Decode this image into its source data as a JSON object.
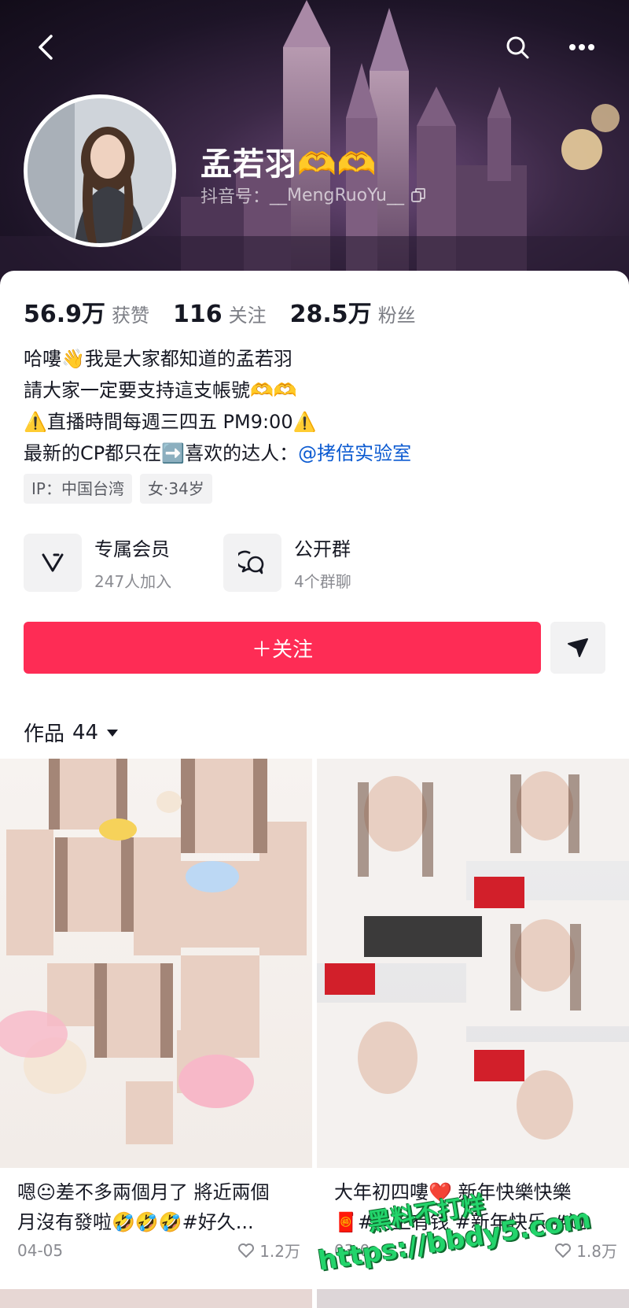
{
  "profile": {
    "name": "孟若羽🫶🫶",
    "id_label": "抖音号：",
    "id_value": "__MengRuoYu__"
  },
  "stats": [
    {
      "value": "56.9万",
      "label": "获赞"
    },
    {
      "value": "116",
      "label": "关注"
    },
    {
      "value": "28.5万",
      "label": "粉丝"
    }
  ],
  "bio": {
    "line1": "哈嘍👋我是大家都知道的孟若羽",
    "line2": "請大家一定要支持這支帳號🫶🫶",
    "line3": "⚠️直播時間每週三四五 PM9:00⚠️",
    "line4_prefix": "最新的CP都只在➡️喜欢的达人：",
    "line4_mention": "@拷倍实验室"
  },
  "tags": [
    "IP：中国台湾",
    "女·34岁"
  ],
  "features": [
    {
      "title": "专属会员",
      "subtitle": "247人加入",
      "icon": "member-v-icon"
    },
    {
      "title": "公开群",
      "subtitle": "4个群聊",
      "icon": "group-chat-icon"
    }
  ],
  "follow_label": "＋关注",
  "works": {
    "label": "作品",
    "count": "44"
  },
  "videos": [
    {
      "caption1": "嗯😐差不多兩個月了 將近兩個",
      "caption2": "月沒有發啦🤣🤣🤣#好久...",
      "date": "04-05",
      "likes": "1.2万"
    },
    {
      "caption1": "大年初四嘍❤️ 新年快樂快樂",
      "caption2": "🧧#马上有钱 #新年快乐 #过",
      "date": "03-0",
      "likes": "1.8万"
    }
  ],
  "watermark": {
    "title": "黑料不打烊",
    "url": "https://bbdy5.com"
  },
  "colors": {
    "accent": "#fe2c55",
    "mention": "#0b5ad1",
    "watermark": "#23d46b"
  }
}
